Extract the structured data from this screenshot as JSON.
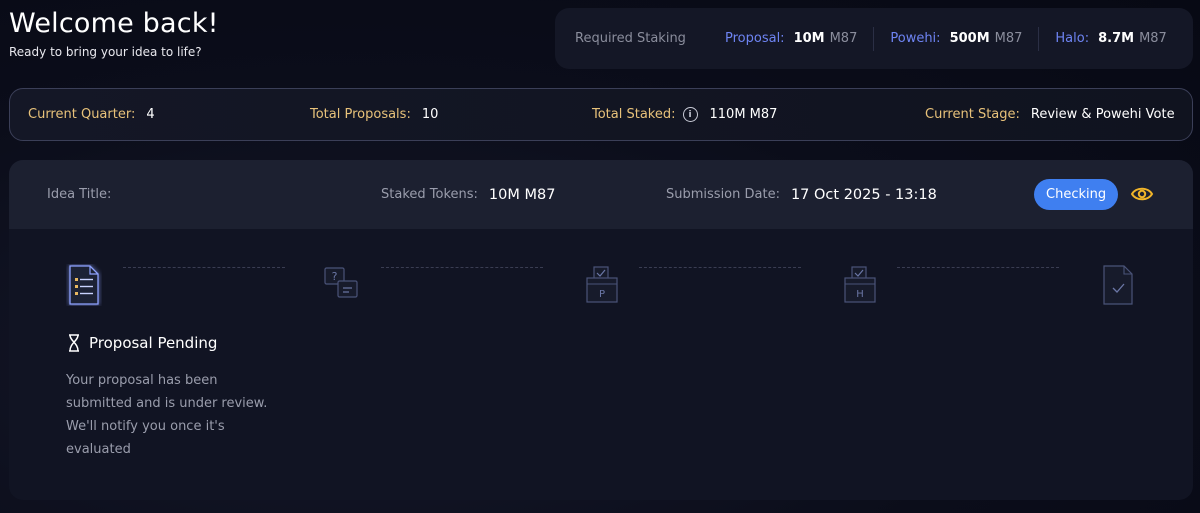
{
  "header": {
    "title": "Welcome back!",
    "subtitle": "Ready to bring your idea to life?"
  },
  "staking": {
    "label": "Required Staking",
    "items": [
      {
        "label": "Proposal:",
        "value": "10M",
        "unit": "M87"
      },
      {
        "label": "Powehi:",
        "value": "500M",
        "unit": "M87"
      },
      {
        "label": "Halo:",
        "value": "8.7M",
        "unit": "M87"
      }
    ]
  },
  "summary": {
    "quarter_label": "Current Quarter:",
    "quarter_value": "4",
    "proposals_label": "Total Proposals:",
    "proposals_value": "10",
    "staked_label": "Total Staked:",
    "staked_value": "110M M87",
    "stage_label": "Current Stage:",
    "stage_value": "Review & Powehi Vote"
  },
  "proposal": {
    "title_label": "Idea Title:",
    "title_value": "",
    "staked_label": "Staked Tokens:",
    "staked_value": "10M M87",
    "date_label": "Submission Date:",
    "date_value": "17 Oct 2025 - 13:18",
    "status_badge": "Checking",
    "steps": [
      {
        "icon": "document-list-icon",
        "active": true
      },
      {
        "icon": "question-chat-icon",
        "active": false
      },
      {
        "icon": "ballot-box-p-icon",
        "box_letter": "P",
        "active": false
      },
      {
        "icon": "ballot-box-h-icon",
        "box_letter": "H",
        "active": false
      },
      {
        "icon": "document-check-icon",
        "active": false
      }
    ],
    "status_title": "Proposal Pending",
    "status_description": "Your proposal has been submitted and is under review. We'll notify you once it's evaluated"
  },
  "colors": {
    "accent_blue": "#6e84f3",
    "gold_label": "#e8c27a",
    "badge_blue": "#3f7ff0",
    "eye_gold": "#f0b429"
  }
}
